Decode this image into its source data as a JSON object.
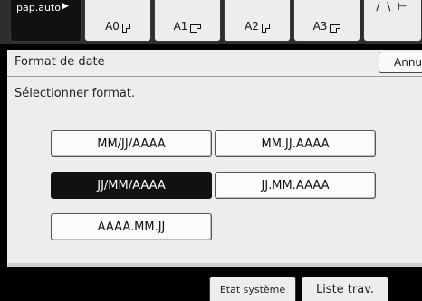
{
  "trays": [
    {
      "label": "pap.auto",
      "icon": "play-arrow-icon",
      "active": true
    },
    {
      "label": "A0",
      "icon": "portrait-paper-icon"
    },
    {
      "label": "A1",
      "icon": "landscape-paper-icon"
    },
    {
      "label": "A2",
      "icon": "portrait-paper-icon"
    },
    {
      "label": "A3",
      "icon": "landscape-paper-icon"
    }
  ],
  "tray_more_glyph": "/ \\ ⊢",
  "panel": {
    "title": "Format de date",
    "cancel_label": "Annuler",
    "instruction": "Sélectionner format."
  },
  "formats": [
    {
      "label": "MM/JJ/AAAA",
      "selected": false
    },
    {
      "label": "MM.JJ.AAAA",
      "selected": false
    },
    {
      "label": "JJ/MM/AAAA",
      "selected": true
    },
    {
      "label": "JJ.MM.AAAA",
      "selected": false
    },
    {
      "label": "AAAA.MM.JJ",
      "selected": false
    }
  ],
  "footer": {
    "system_status": "Etat système",
    "job_list": "Liste trav."
  },
  "colors": {
    "panel_bg": "#ededed",
    "selected_bg": "#111111",
    "screen_bg": "#000000"
  }
}
